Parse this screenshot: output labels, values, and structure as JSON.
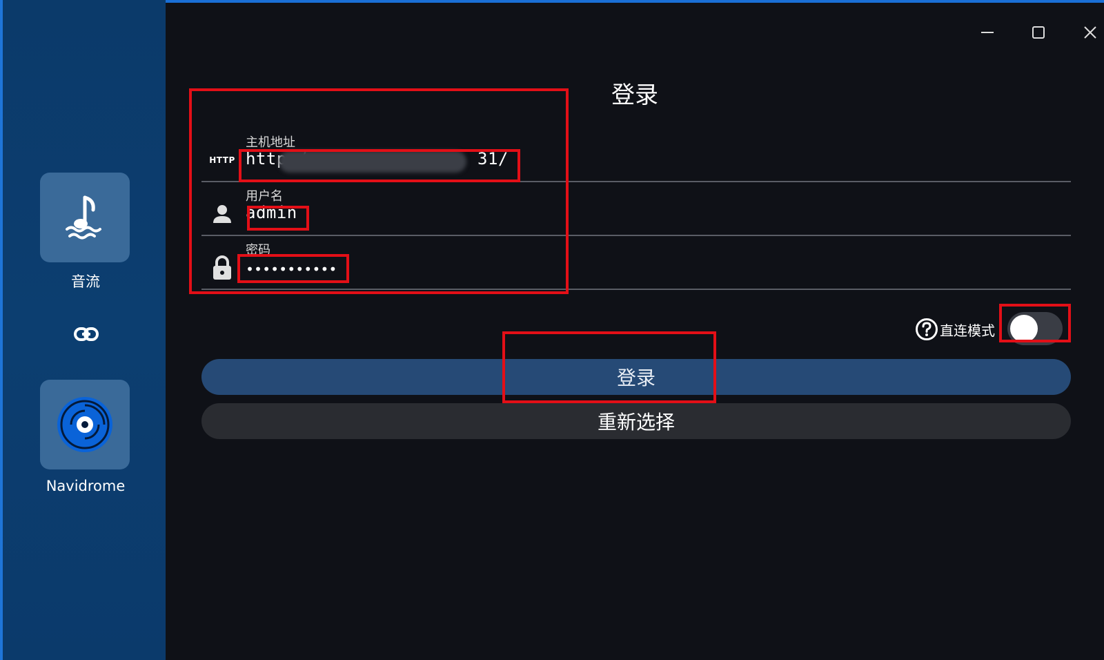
{
  "sidebar": {
    "apps": [
      {
        "label": "音流",
        "icon": "music-note-wave-icon"
      },
      {
        "label": "Navidrome",
        "icon": "vinyl-disc-icon"
      }
    ],
    "link_icon": "link-icon"
  },
  "window": {
    "minimize_icon": "minimize-icon",
    "maximize_icon": "maximize-icon",
    "close_icon": "close-icon"
  },
  "login": {
    "title": "登录",
    "fields": {
      "host": {
        "icon_text": "HTTP",
        "label": "主机地址",
        "value_prefix": "http:/",
        "value_suffix": "31/"
      },
      "username": {
        "label": "用户名",
        "value": "admin"
      },
      "password": {
        "label": "密码",
        "value": "•••••••••••"
      }
    },
    "direct_mode": {
      "label": "直连模式",
      "enabled": false
    },
    "login_button": "登录",
    "reselect_button": "重新选择"
  },
  "colors": {
    "annotation": "#e30f17",
    "primary_button": "#264a76",
    "sidebar": "#0b3a6a",
    "background": "#0f1117"
  }
}
